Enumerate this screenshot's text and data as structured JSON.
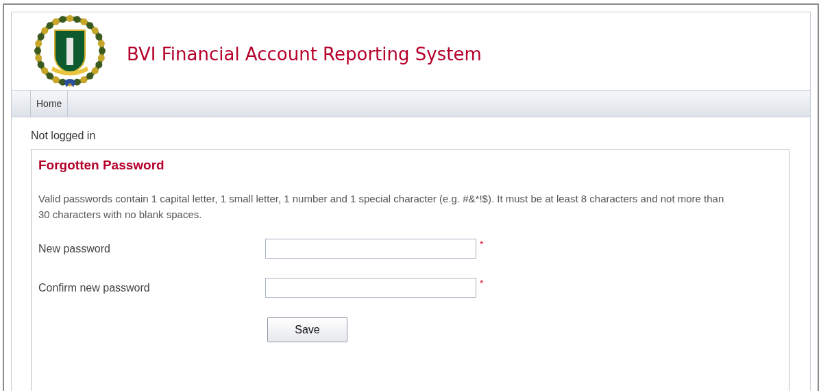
{
  "header": {
    "title": "BVI Financial Account Reporting System"
  },
  "nav": {
    "items": [
      {
        "label": "Home",
        "selected": false
      }
    ]
  },
  "login_status": "Not logged in",
  "form": {
    "title": "Forgotten Password",
    "description": "Valid passwords contain 1 capital letter, 1 small letter, 1 number and 1 special character (e.g. #&*!$). It must be at least 8 characters and not more than 30 characters with no blank spaces.",
    "fields": [
      {
        "label": "New password",
        "required_mark": "*"
      },
      {
        "label": "Confirm new password",
        "required_mark": "*"
      }
    ],
    "button": "Save"
  }
}
